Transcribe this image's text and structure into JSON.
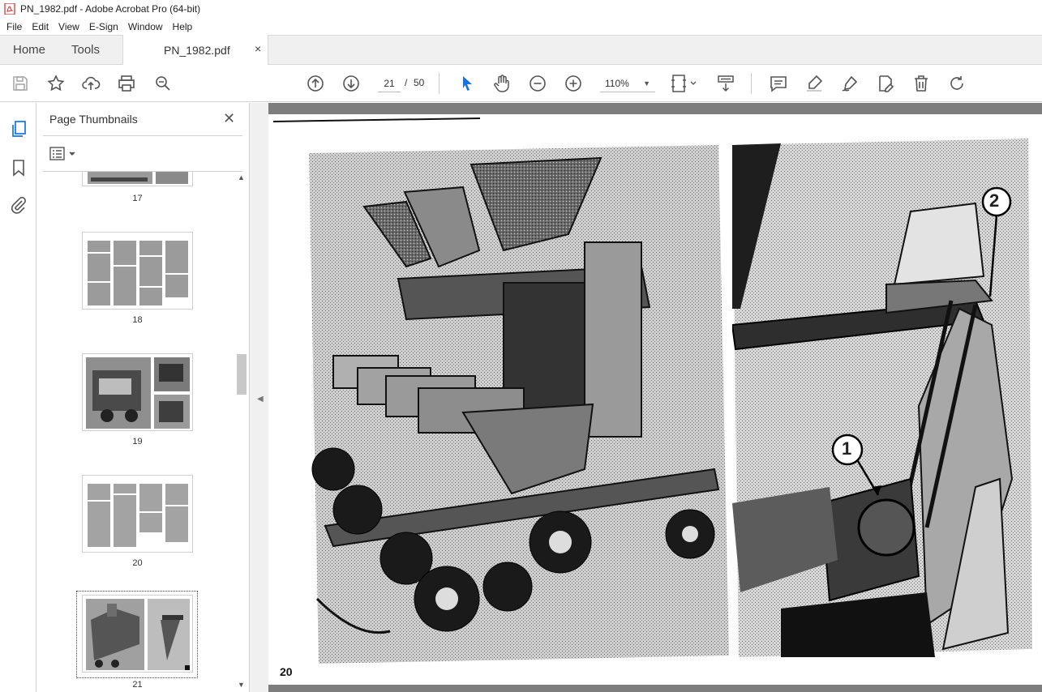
{
  "window": {
    "title": "PN_1982.pdf - Adobe Acrobat Pro (64-bit)"
  },
  "menu": [
    "File",
    "Edit",
    "View",
    "E-Sign",
    "Window",
    "Help"
  ],
  "tabs": {
    "home": "Home",
    "tools": "Tools",
    "document": "PN_1982.pdf",
    "close": "×"
  },
  "toolbar": {
    "current_page": "21",
    "page_separator": "/",
    "total_pages": "50",
    "zoom": "110%"
  },
  "thumbnails_panel": {
    "title": "Page Thumbnails",
    "close": "✕",
    "pages": [
      {
        "label": "17"
      },
      {
        "label": "18"
      },
      {
        "label": "19"
      },
      {
        "label": "20"
      },
      {
        "label": "21",
        "selected": true
      }
    ]
  },
  "document": {
    "page_number": "20",
    "callouts": [
      "1",
      "2"
    ]
  },
  "colors": {
    "accent": "#1473e6",
    "pdf_red": "#d9261c",
    "canvas_gray": "#7d7d7d"
  }
}
